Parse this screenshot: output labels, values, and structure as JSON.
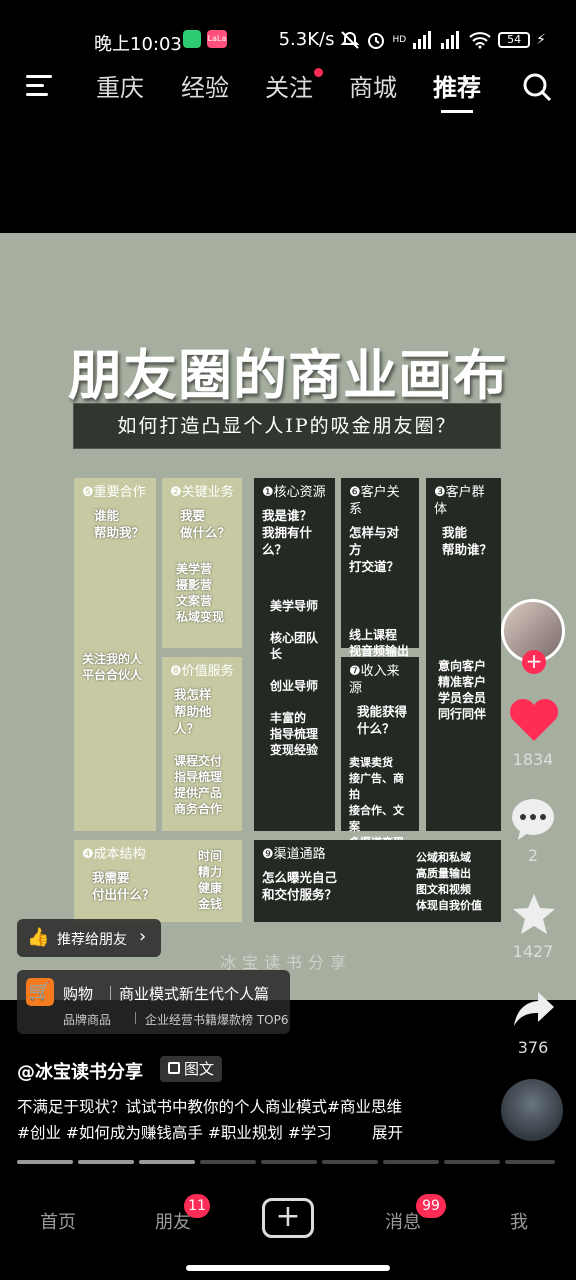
{
  "status_bar": {
    "time": "晚上10:03",
    "mini_badge": "LaLa",
    "net_speed": "5.3K/s",
    "signal_tag": "HD",
    "battery": "54"
  },
  "nav": {
    "tabs": [
      {
        "label": "重庆"
      },
      {
        "label": "经验"
      },
      {
        "label": "关注"
      },
      {
        "label": "商城"
      },
      {
        "label": "推荐"
      }
    ]
  },
  "post": {
    "title": "朋友圈的商业画布",
    "subtitle": "如何打造凸显个人IP的吸金朋友圈？",
    "cells": {
      "c5": {
        "head": "❺重要合作",
        "q": "谁能\n帮助我？",
        "list": "关注我的人\n平台合伙人"
      },
      "c2": {
        "head": "❷关键业务",
        "q": "我要\n做什么？",
        "list": "美学营\n摄影营\n文案营\n私域变现"
      },
      "c8": {
        "head": "❽价值服务",
        "q": "我怎样\n帮助他人？",
        "list": "课程交付\n指导梳理\n提供产品\n商务合作"
      },
      "c1": {
        "head": "❶核心资源",
        "q": "我是谁？\n我拥有什么？",
        "list": "美学导师\n\n核心团队长\n\n创业导师\n\n丰富的\n指导梳理\n变现经验"
      },
      "c6": {
        "head": "❻客户关系",
        "q": "怎样与对方\n打交道？",
        "list": "线上课程\n视音频输出"
      },
      "c7": {
        "head": "❼收入来源",
        "q": "我能获得\n什么？",
        "list": "卖课卖货\n接广告、商拍\n接合作、文案\n多渠道变现"
      },
      "c3": {
        "head": "❸客户群体",
        "q": "我能\n帮助谁？",
        "list": "意向客户\n精准客户\n学员会员\n同行同伴"
      },
      "c4": {
        "head": "❹成本结构",
        "q": "我需要\n付出什么？",
        "list": "时间\n精力\n健康\n金钱"
      },
      "c9": {
        "head": "❾渠道通路",
        "q": "怎么曝光自己\n和交付服务？",
        "list": "公域和私域\n高质量输出\n图文和视频\n体现自我价值"
      }
    },
    "watermark": "冰宝读书分享"
  },
  "recommend_pill": {
    "label": "推荐给朋友"
  },
  "shop_card": {
    "tag": "购物",
    "title": "商业模式新生代个人篇",
    "sub1": "品牌商品",
    "sub2": "企业经营书籍爆款榜 TOP6"
  },
  "right_rail": {
    "likes": "1834",
    "comments": "2",
    "favorites": "1427",
    "shares": "376"
  },
  "author": {
    "handle": "@冰宝读书分享",
    "type_tag": "图文"
  },
  "caption": {
    "line1": "不满足于现状？试试书中教你的个人商业模式#商业思维",
    "line2": "#创业 #如何成为赚钱高手 #职业规划 #学习",
    "expand": "展开"
  },
  "bottom_nav": {
    "home": "首页",
    "friends": "朋友",
    "friends_badge": "11",
    "messages": "消息",
    "messages_badge": "99",
    "me": "我"
  },
  "colors": {
    "like": "#ff2d55",
    "canvas_bg": "#a5ae9f",
    "cell_light": "#c6c9a1",
    "cell_dark": "#232923"
  }
}
